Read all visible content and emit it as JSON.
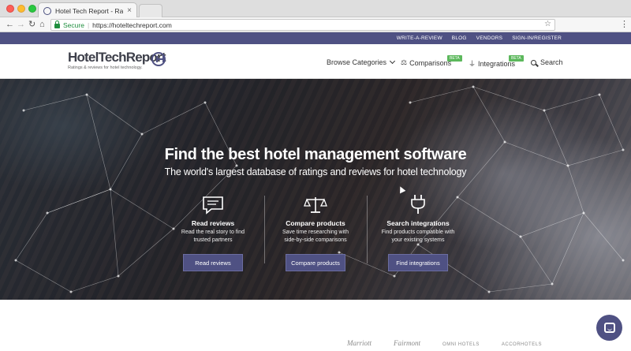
{
  "browser": {
    "tab_title": "Hotel Tech Report - Ratings a",
    "tab_close": "×",
    "secure_label": "Secure",
    "url": "https://hoteltechreport.com",
    "bookmark_glyph": "☆",
    "menu_glyph": "⋮",
    "back_glyph": "←",
    "forward_glyph": "→",
    "reload_glyph": "↻",
    "home_glyph": "⌂"
  },
  "utility_nav": {
    "links": [
      "WRITE-A-REVIEW",
      "BLOG",
      "VENDORS",
      "SIGN-IN/REGISTER"
    ]
  },
  "header": {
    "logo_text": "HotelTechReport",
    "logo_tagline": "Ratings & reviews for hotel technology.",
    "nav": {
      "browse": "Browse Categories",
      "comparisons": "Comparisons",
      "integrations": "Integrations",
      "search": "Search",
      "beta_badge": "BETA"
    }
  },
  "hero": {
    "title": "Find the best hotel management software",
    "subtitle": "The world's largest database of ratings and reviews for hotel technology",
    "columns": [
      {
        "icon": "chat-bubble-icon",
        "title": "Read reviews",
        "desc_line1": "Read the real story to find",
        "desc_line2": "trusted partners",
        "button": "Read reviews"
      },
      {
        "icon": "scales-icon",
        "title": "Compare products",
        "desc_line1": "Save time researching with",
        "desc_line2": "side-by-side comparisons",
        "button": "Compare products"
      },
      {
        "icon": "plug-icon",
        "title": "Search integrations",
        "desc_line1": "Find products compatible with",
        "desc_line2": "your existing systems",
        "button": "Find integrations"
      }
    ]
  },
  "partner_logos": [
    "Marriott",
    "Fairmont",
    "OMNI HOTELS",
    "ACCORHOTELS"
  ],
  "colors": {
    "brand": "#4f5183",
    "beta": "#5cb85c"
  }
}
